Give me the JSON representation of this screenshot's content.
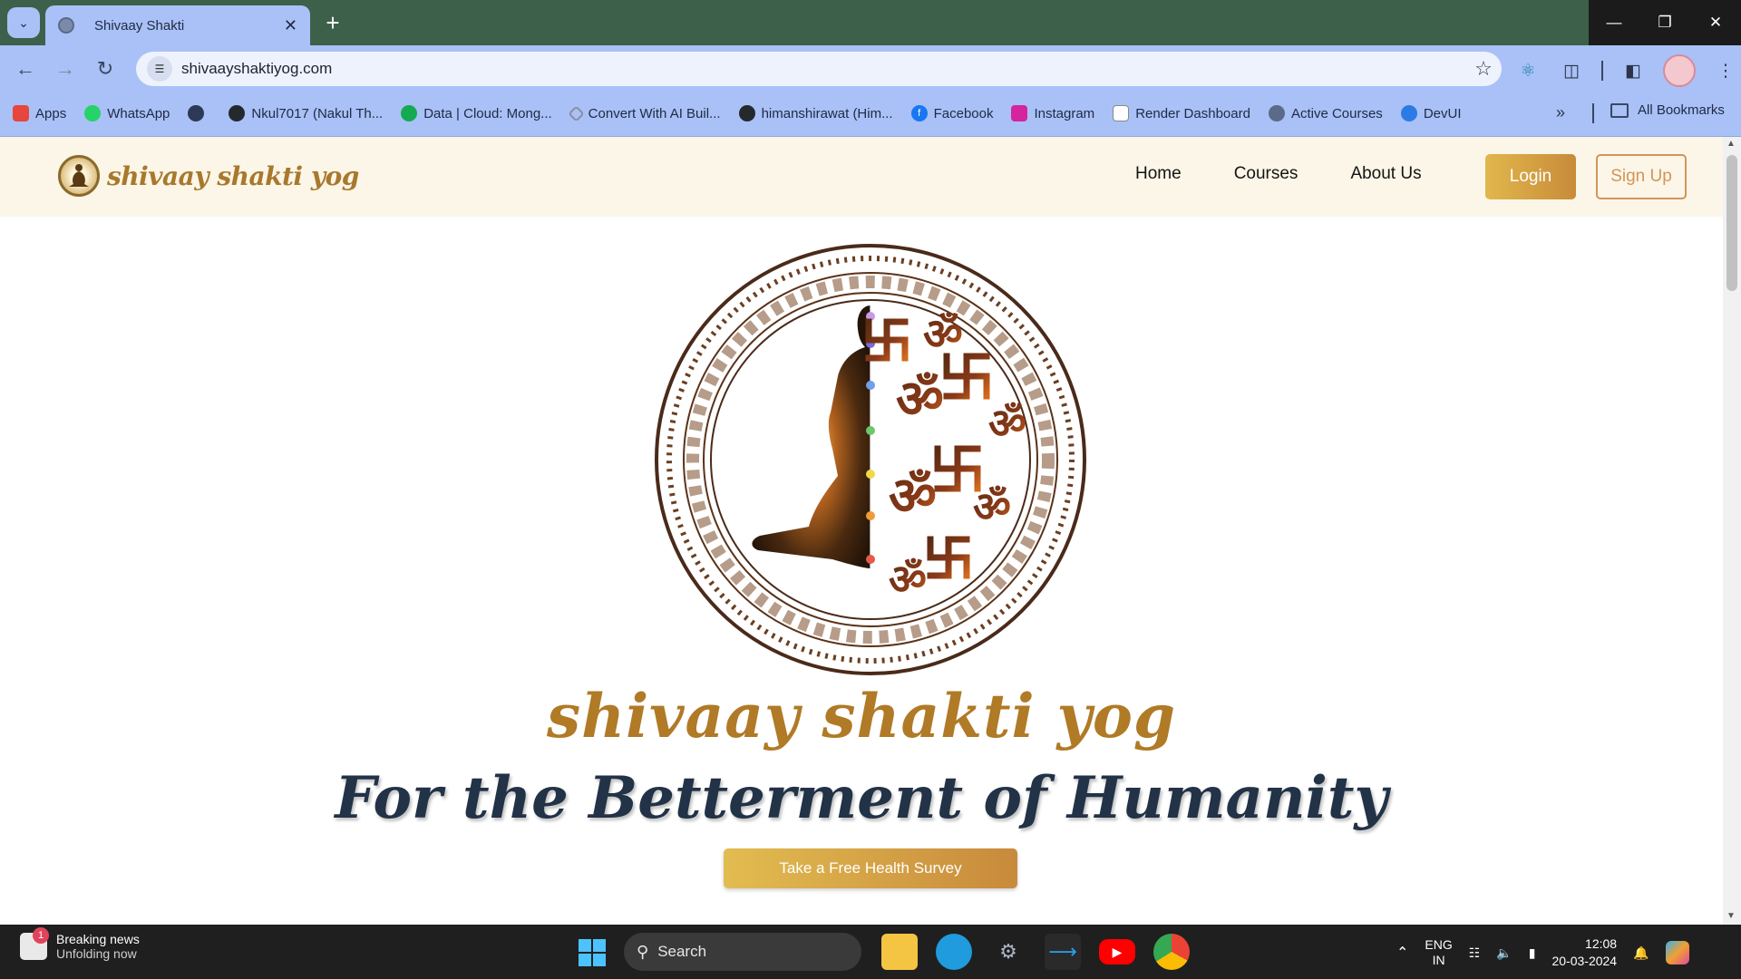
{
  "browser": {
    "tab_title": "Shivaay Shakti",
    "url": "shivaayshaktiyog.com",
    "bookmarks": [
      {
        "label": "Apps",
        "color": "#e8453c"
      },
      {
        "label": "WhatsApp",
        "color": "#25d366"
      },
      {
        "label": "",
        "color": "#2c3a57"
      },
      {
        "label": "Nkul7017 (Nakul Th...",
        "color": "#24292e"
      },
      {
        "label": "Data | Cloud: Mong...",
        "color": "#13aa52"
      },
      {
        "label": "Convert With AI Buil...",
        "color": "#8a8fa0"
      },
      {
        "label": "himanshirawat (Him...",
        "color": "#24292e"
      },
      {
        "label": "Facebook",
        "color": "#1877f2"
      },
      {
        "label": "Instagram",
        "color": "#d6249f"
      },
      {
        "label": "Render Dashboard",
        "color": "#ffffff"
      },
      {
        "label": "Active Courses",
        "color": "#5a6a88"
      },
      {
        "label": "DevUI",
        "color": "#2c7be5"
      }
    ],
    "all_bookmarks": "All Bookmarks"
  },
  "site": {
    "nav": {
      "home": "Home",
      "courses": "Courses",
      "about": "About Us",
      "login": "Login",
      "signup": "Sign Up"
    },
    "logo_text": "shivaay shakti yog",
    "hero": {
      "brand_name": "shivaay shakti yog",
      "tagline": "For the Betterment of Humanity",
      "cta": "Take a Free Health Survey"
    },
    "colors": {
      "gold": "#d8a646",
      "navy": "#223247",
      "cream": "#fbf6e7"
    }
  },
  "taskbar": {
    "news_title": "Breaking news",
    "news_sub": "Unfolding now",
    "news_badge": "1",
    "search": "Search",
    "lang1": "ENG",
    "lang2": "IN",
    "time": "12:08",
    "date": "20-03-2024"
  }
}
